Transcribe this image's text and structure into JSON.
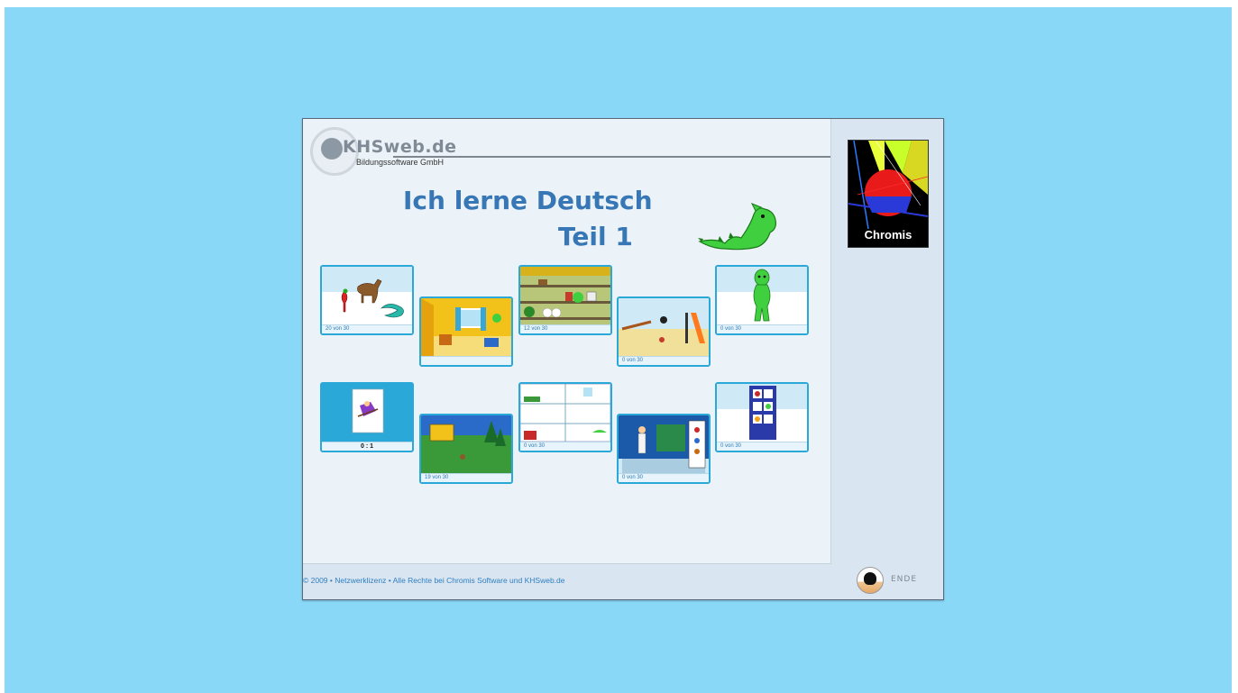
{
  "brand": {
    "name": "KHSweb.de",
    "subtitle": "Bildungssoftware GmbH"
  },
  "title": {
    "line1": "Ich lerne Deutsch",
    "line2": "Teil 1"
  },
  "cards": [
    {
      "id": "tiere",
      "status": "20 von 30"
    },
    {
      "id": "wohnzimmer",
      "status": ""
    },
    {
      "id": "supermarkt",
      "status": "12 von 30"
    },
    {
      "id": "spielplatz",
      "status": "0 von 30"
    },
    {
      "id": "drache",
      "status": "0 von 30"
    },
    {
      "id": "memory",
      "status": "0 : 1"
    },
    {
      "id": "wald",
      "status": "19 von 30"
    },
    {
      "id": "haus",
      "status": "0 von 30"
    },
    {
      "id": "kleidung",
      "status": "0 von 30"
    },
    {
      "id": "regal",
      "status": "0 von 30"
    }
  ],
  "footer": {
    "copyright": "© 2009 • Netzwerklizenz • Alle Rechte bei Chromis Software und KHSweb.de"
  },
  "end_button": {
    "label": "ENDE"
  },
  "chromis_logo": {
    "label": "Chromis"
  },
  "colors": {
    "background": "#8ad8f8",
    "title": "#3777b5",
    "card_border": "#2aa8d8"
  }
}
